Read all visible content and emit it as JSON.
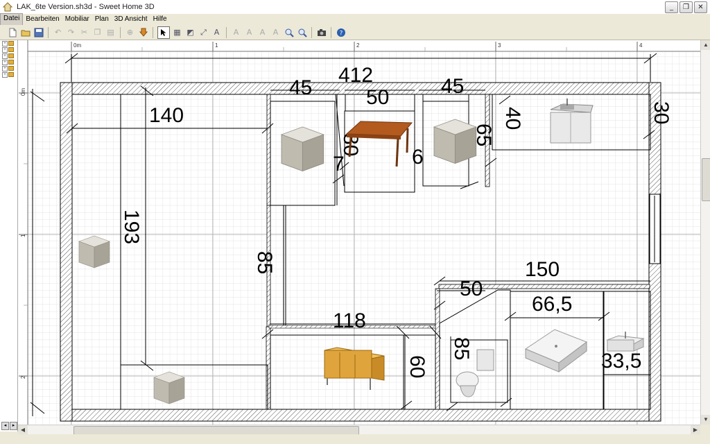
{
  "window": {
    "title": "LAK_6te Version.sh3d - Sweet Home 3D",
    "min_glyph": "_",
    "max_glyph": "❐",
    "close_glyph": "✕"
  },
  "menu": [
    "Datei",
    "Bearbeiten",
    "Mobiliar",
    "Plan",
    "3D Ansicht",
    "Hilfe"
  ],
  "toolbar": {
    "icons": [
      "new-file-icon",
      "open-file-icon",
      "save-file-icon",
      "undo-icon",
      "redo-icon",
      "cut-icon",
      "copy-icon",
      "paste-icon",
      "add-furniture-icon",
      "import-furniture-icon",
      "select-arrow-icon",
      "create-walls-icon",
      "create-rooms-icon",
      "create-dimensions-icon",
      "add-text-icon",
      "increase-text-icon",
      "decrease-text-icon",
      "bold-text-icon",
      "italic-text-icon",
      "zoom-in-icon",
      "zoom-out-icon",
      "create-photo-icon",
      "help-icon"
    ]
  },
  "ruler": {
    "h_ticks": [
      "0m",
      "1",
      "2",
      "3",
      "4"
    ],
    "v_ticks": [
      "0m",
      "1",
      "2"
    ]
  },
  "dimensions": {
    "total_width": "412",
    "d140": "140",
    "d193": "193",
    "d85_left": "85",
    "d45_a": "45",
    "d50_top": "50",
    "d45_b": "45",
    "d80": "80",
    "d7": "7",
    "d6": "6",
    "d65": "65",
    "d40": "40",
    "d30": "30",
    "d150": "150",
    "d50_mid": "50",
    "d66_5": "66,5",
    "d118": "118",
    "d60": "60",
    "d85_bottom": "85",
    "d33_5": "33,5"
  },
  "furniture": [
    "box-left",
    "box-bottom-left",
    "box-upper-a",
    "dining-table",
    "box-upper-b",
    "kitchen-sink-cabinet",
    "sideboard",
    "toilet",
    "shower-tray",
    "washbasin"
  ],
  "colors": {
    "wall_hatch": "#555555",
    "grid_minor": "#d9d9d9",
    "grid_major": "#b5b5b5",
    "box": "#b8b4a6",
    "table_top": "#b35a1f",
    "sideboard": "#e0a43c"
  }
}
